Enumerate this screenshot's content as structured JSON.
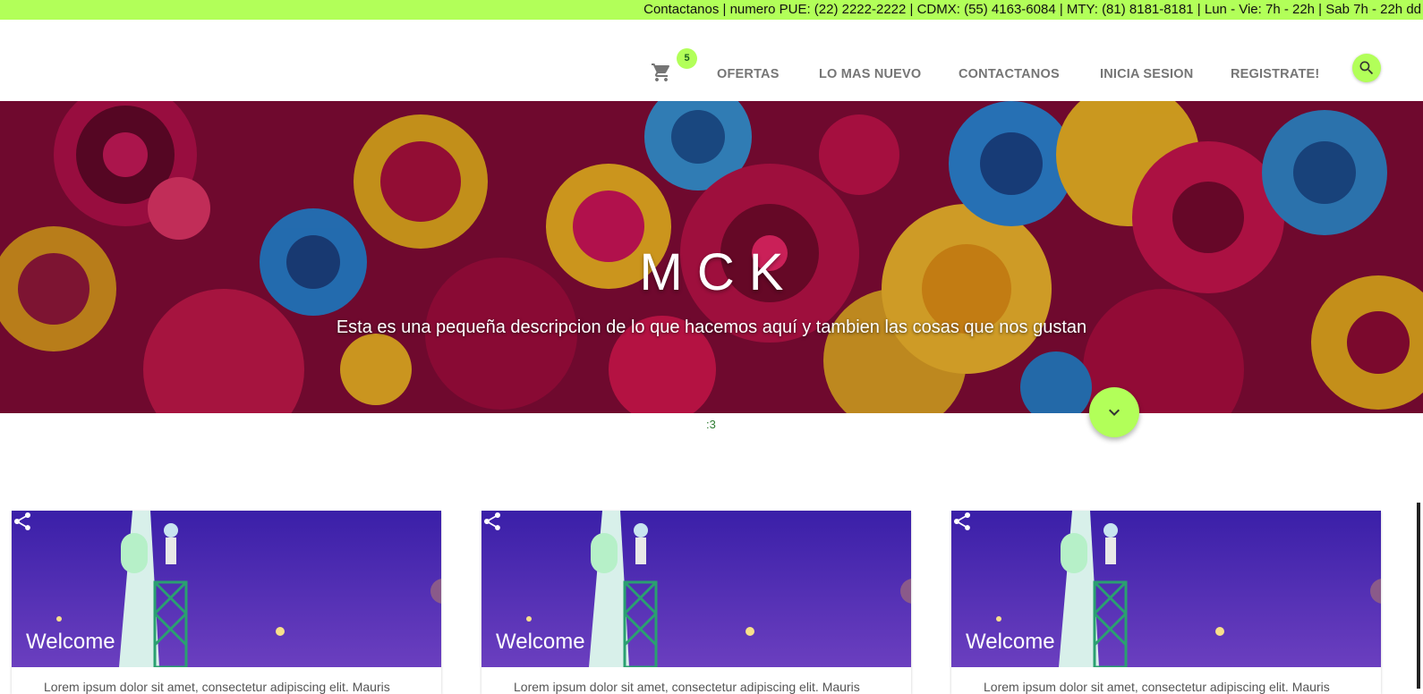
{
  "topbar": {
    "text": "Contactanos | numero PUE: (22) 2222-2222 | CDMX: (55) 4163-6084 | MTY: (81) 8181-8181 | Lun - Vie: 7h - 22h | Sab 7h - 22h dd"
  },
  "nav": {
    "cart_icon": "shopping-cart-icon",
    "cart_count": "5",
    "items": [
      {
        "label": "OFERTAS"
      },
      {
        "label": "LO MAS NUEVO"
      },
      {
        "label": "CONTACTANOS"
      },
      {
        "label": "INICIA SESION"
      },
      {
        "label": "REGISTRATE!"
      }
    ],
    "search_icon": "search-icon"
  },
  "hero": {
    "title": "MCK",
    "subtitle": "Esta es una pequeña descripcion de lo que hacemos aquí y tambien las cosas que nos gustan"
  },
  "fab_icon": "chevron-down-icon",
  "smiley": ":3",
  "cards": [
    {
      "title": "Welcome",
      "text": "Lorem ipsum dolor sit amet, consectetur adipiscing elit. Mauris",
      "share_icon": "share-icon"
    },
    {
      "title": "Welcome",
      "text": "Lorem ipsum dolor sit amet, consectetur adipiscing elit. Mauris",
      "share_icon": "share-icon"
    },
    {
      "title": "Welcome",
      "text": "Lorem ipsum dolor sit amet, consectetur adipiscing elit. Mauris",
      "share_icon": "share-icon"
    }
  ],
  "colors": {
    "accent": "#b2ff59",
    "nav_text": "#757575",
    "card_purple": "#4a2bb0"
  }
}
